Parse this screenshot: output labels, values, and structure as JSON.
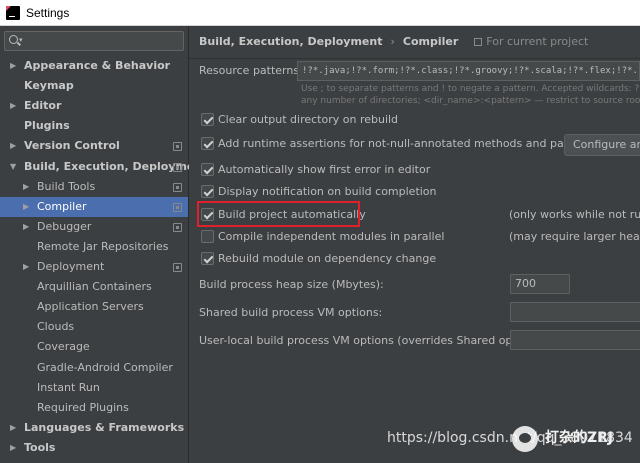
{
  "window": {
    "title": "Settings"
  },
  "search": {
    "placeholder": "Q▾"
  },
  "sidebar": {
    "items": [
      {
        "label": "Appearance & Behavior",
        "arrow": "▶",
        "bold": true
      },
      {
        "label": "Keymap",
        "arrow": "",
        "bold": true
      },
      {
        "label": "Editor",
        "arrow": "▶",
        "bold": true
      },
      {
        "label": "Plugins",
        "arrow": "",
        "bold": true
      },
      {
        "label": "Version Control",
        "arrow": "▶",
        "bold": true
      },
      {
        "label": "Build, Execution, Deployment",
        "arrow": "▼",
        "bold": true
      },
      {
        "label": "Build Tools",
        "arrow": "▶",
        "bold": false
      },
      {
        "label": "Compiler",
        "arrow": "▶",
        "bold": false,
        "selected": true
      },
      {
        "label": "Debugger",
        "arrow": "▶",
        "bold": false
      },
      {
        "label": "Remote Jar Repositories",
        "arrow": "",
        "bold": false
      },
      {
        "label": "Deployment",
        "arrow": "▶",
        "bold": false
      },
      {
        "label": "Arquillian Containers",
        "arrow": "",
        "bold": false
      },
      {
        "label": "Application Servers",
        "arrow": "",
        "bold": false
      },
      {
        "label": "Clouds",
        "arrow": "",
        "bold": false
      },
      {
        "label": "Coverage",
        "arrow": "",
        "bold": false
      },
      {
        "label": "Gradle-Android Compiler",
        "arrow": "",
        "bold": false
      },
      {
        "label": "Instant Run",
        "arrow": "",
        "bold": false
      },
      {
        "label": "Required Plugins",
        "arrow": "",
        "bold": false
      },
      {
        "label": "Languages & Frameworks",
        "arrow": "▶",
        "bold": true
      },
      {
        "label": "Tools",
        "arrow": "▶",
        "bold": true
      }
    ]
  },
  "breadcrumb": {
    "parent": "Build, Execution, Deployment",
    "separator": "›",
    "current": "Compiler",
    "scope": "For current project"
  },
  "compiler": {
    "resource_patterns_label": "Resource patterns:",
    "resource_patterns_value": "!?*.java;!?*.form;!?*.class;!?*.groovy;!?*.scala;!?*.flex;!?*.kt;!?*.clj",
    "hint_line1": "Use ; to separate patterns and ! to negate a pattern. Accepted wildcards: ? — exa",
    "hint_line2": "any number of directories; <dir_name>:<pattern> — restrict to source roots with",
    "options": {
      "clear_output": "Clear output directory on rebuild",
      "runtime_assertions": "Add runtime assertions for not-null-annotated methods and parameters",
      "configure_annotations": "Configure anno",
      "show_first_error": "Automatically show first error in editor",
      "display_notification": "Display notification on build completion",
      "build_automatically": "Build project automatically",
      "build_automatically_note": "(only works while not runnin",
      "compile_parallel": "Compile independent modules in parallel",
      "compile_parallel_note": "(may require larger heap siz",
      "rebuild_on_change": "Rebuild module on dependency change"
    },
    "heap_size_label": "Build process heap size (Mbytes):",
    "heap_size_value": "700",
    "shared_vm_label": "Shared build process VM options:",
    "user_vm_label": "User-local build process VM options (overrides Shared options):"
  },
  "watermark": {
    "url": "https://blog.csdn.net/qq_38071834",
    "brand": "打杂的ZRJ"
  },
  "colors": {
    "background": "#3c3f41",
    "selection": "#4b6eaf",
    "highlight_box": "#e0212b"
  }
}
